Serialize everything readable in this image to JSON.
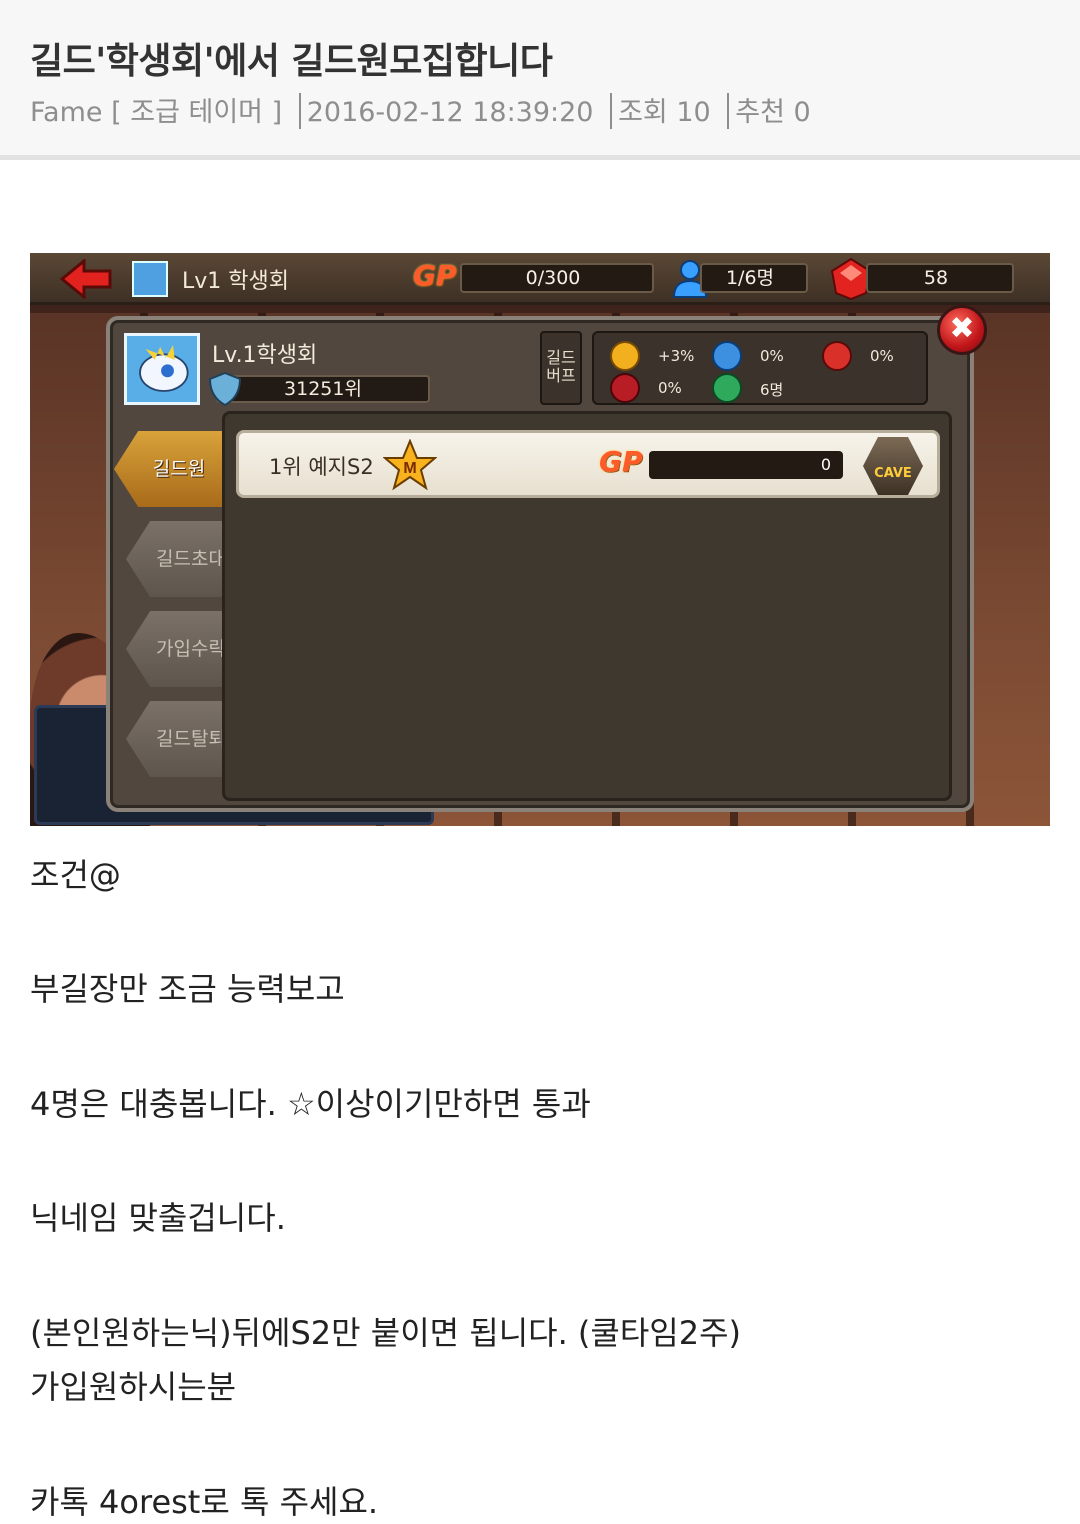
{
  "post": {
    "title": "길드'학생회'에서 길드원모집합니다",
    "author": "Fame",
    "author_rank": "[ 조급 테이머 ]",
    "date": "2016-02-12 18:39:20",
    "views": "조회 10",
    "recommend": "추천 0"
  },
  "game": {
    "topbar": {
      "guild_title": "Lv1 학생회",
      "gp_label": "GP",
      "gp_value": "0/300",
      "members": "1/6명",
      "gems": "58"
    },
    "guild": {
      "name": "Lv.1학생회",
      "rank": "31251위",
      "buff_tab": "길드\n버프",
      "buffs": [
        {
          "icon": "gold-coin-icon",
          "value": "+3%",
          "color": "#f2b01e"
        },
        {
          "icon": "exp-icon",
          "value": "0%",
          "color": "#3d8fe0"
        },
        {
          "icon": "red-gem-icon",
          "value": "0%",
          "color": "#d9302a"
        },
        {
          "icon": "blood-drop-icon",
          "value": "0%",
          "color": "#b81c24"
        },
        {
          "icon": "member-plus-icon",
          "value": "6명",
          "color": "#2faa5c"
        }
      ]
    },
    "side_tabs": [
      "길드원",
      "길드초대",
      "가입수락",
      "길드탈퇴"
    ],
    "member": {
      "rank_name": "1위 예지S2",
      "star_letter": "M",
      "gp_label": "GP",
      "gp_value": "0",
      "cave_label": "CAVE"
    },
    "close_label": "✖"
  },
  "body": {
    "lines": [
      "조건@",
      "부길장만 조금 능력보고",
      "4명은 대충봅니다. ☆이상이기만하면 통과",
      "닉네임 맞출겁니다.",
      "(본인원하는닉)뒤에S2만 붙이면 됩니다. (쿨타임2주)",
      "가입원하시는분",
      "카톡 4orest로 톡 주세요."
    ]
  }
}
